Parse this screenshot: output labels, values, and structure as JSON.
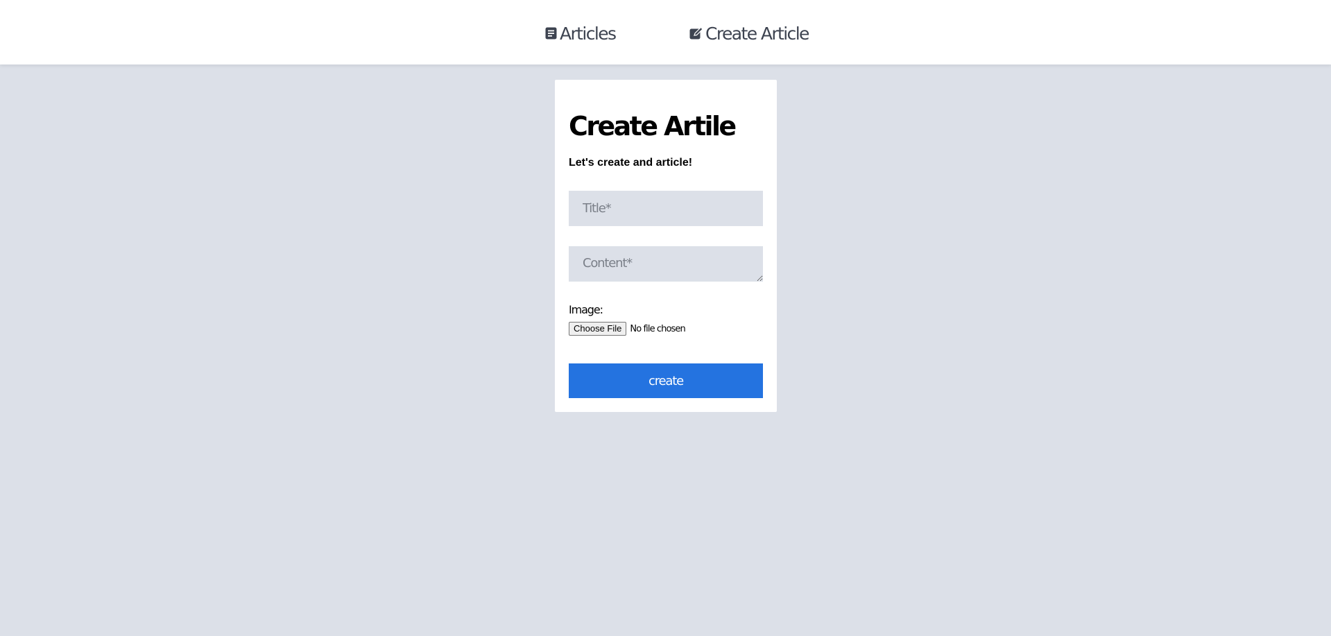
{
  "nav": {
    "articles_label": "Articles",
    "articles_icon": "document-list-icon",
    "create_label": "Create Article",
    "create_icon": "edit-square-icon"
  },
  "form": {
    "title": "Create Artile",
    "subtitle": "Let's create and article!",
    "title_placeholder": "Title*",
    "content_placeholder": "Content*",
    "image_label": "Image:",
    "choose_file_label": "Choose File",
    "file_status": "No file chosen",
    "submit_label": "create"
  },
  "colors": {
    "background": "#dce0e8",
    "card": "#ffffff",
    "accent": "#2473e0",
    "nav_text": "#3d4350"
  }
}
